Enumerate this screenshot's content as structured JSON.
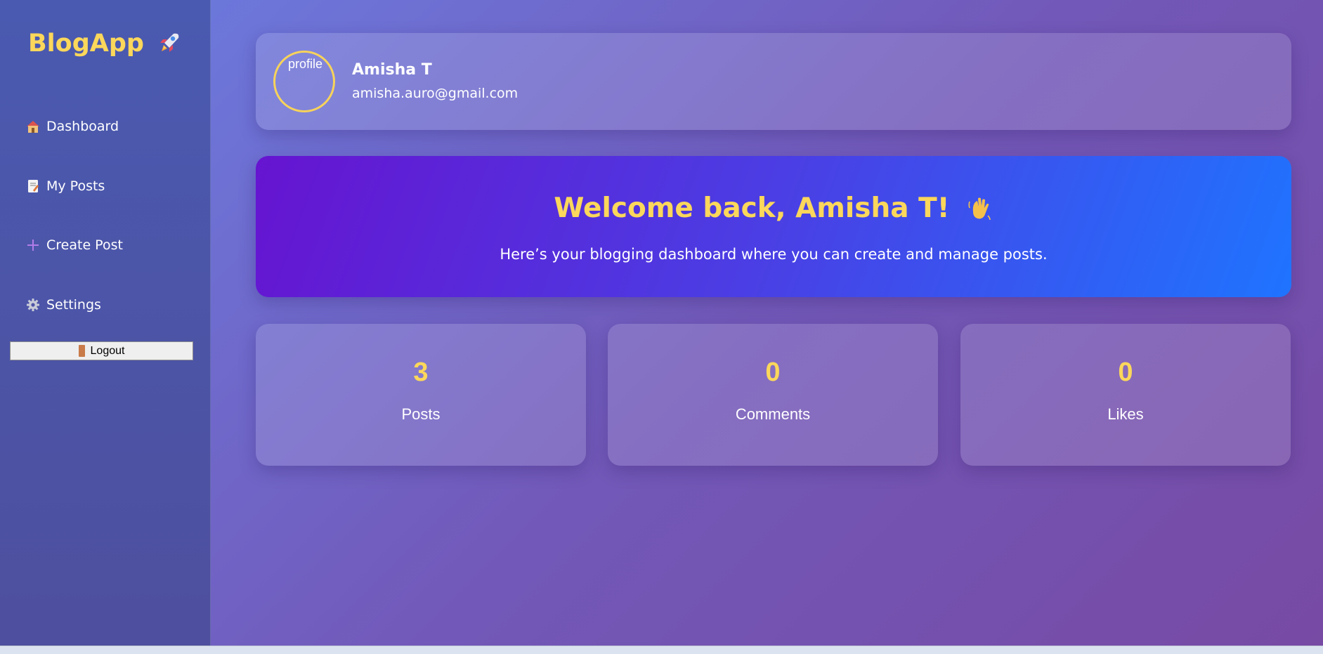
{
  "sidebar": {
    "brand": "BlogApp",
    "brand_icon": "rocket-icon",
    "items": [
      {
        "label": "Dashboard",
        "icon": "house-icon"
      },
      {
        "label": "My Posts",
        "icon": "document-icon"
      },
      {
        "label": "Create Post",
        "icon": "plus-icon"
      },
      {
        "label": "Settings",
        "icon": "gear-icon"
      }
    ],
    "logout_label": "Logout",
    "logout_icon": "door-icon"
  },
  "profile": {
    "avatar_alt": "profile",
    "name": "Amisha T",
    "email": "amisha.auro@gmail.com"
  },
  "welcome": {
    "title": "Welcome back, Amisha T!",
    "subtitle": "Here’s your blogging dashboard where you can create and manage posts.",
    "icon": "waving-hand-icon"
  },
  "stats": [
    {
      "value": "3",
      "label": "Posts"
    },
    {
      "value": "0",
      "label": "Comments"
    },
    {
      "value": "0",
      "label": "Likes"
    }
  ],
  "colors": {
    "accent": "#fbd75b",
    "welcome_start": "#6614d0",
    "welcome_end": "#1f74ff"
  }
}
